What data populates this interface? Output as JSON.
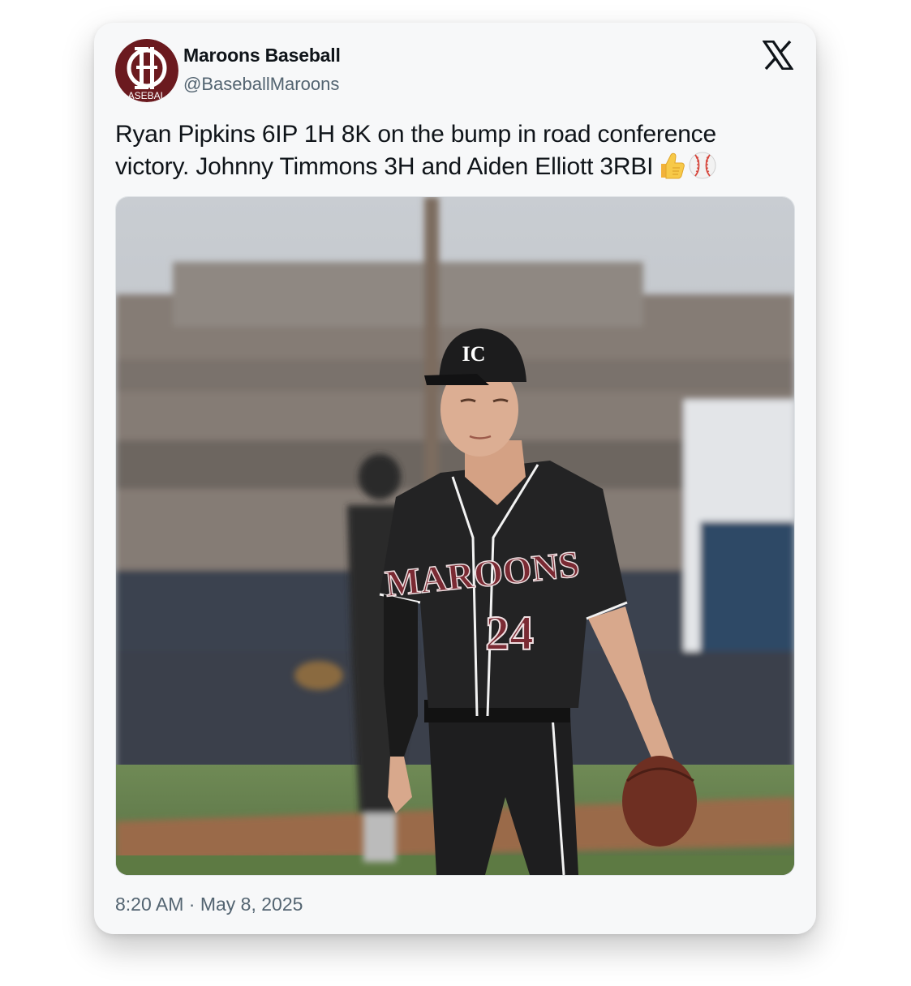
{
  "account": {
    "display_name": "Maroons Baseball",
    "handle": "@BaseballMaroons",
    "avatar_text": "BASEBALL",
    "avatar_monogram": "IC",
    "avatar_color": "#6b1a1f"
  },
  "tweet": {
    "text": "Ryan Pipkins 6IP 1H 8K on the bump in road conference victory. Johnny Timmons 3H and Aiden Elliott 3RBI",
    "emojis": [
      "thumbs-up-icon",
      "baseball-icon"
    ],
    "timestamp": "8:20 AM · May 8, 2025"
  },
  "media": {
    "description_icon": "photo",
    "jersey_team": "MAROONS",
    "jersey_number": "24",
    "cap_logo": "IC"
  },
  "brand": {
    "platform_icon": "x-logo-icon"
  },
  "colors": {
    "text_primary": "#0f1419",
    "text_secondary": "#536471",
    "card_bg": "#f7f8f9",
    "maroon": "#6b1a1f"
  }
}
